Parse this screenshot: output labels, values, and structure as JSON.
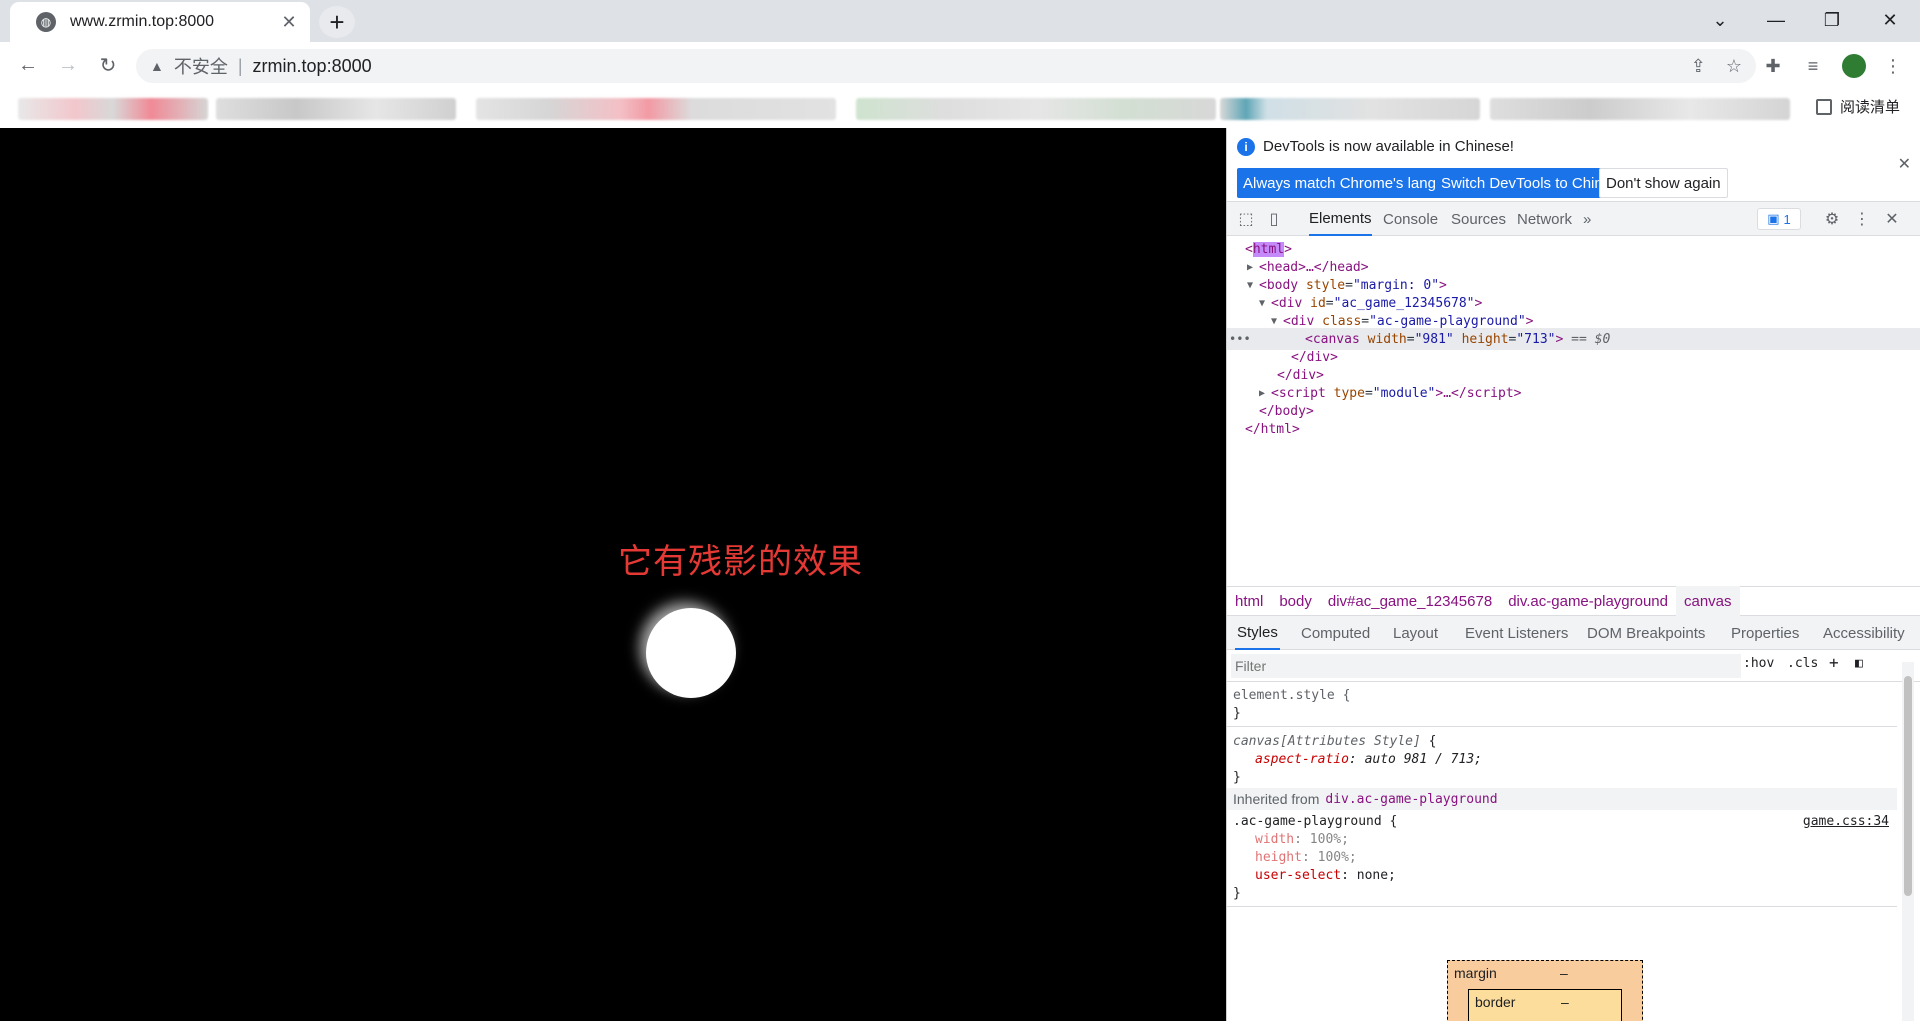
{
  "browser": {
    "tab_title": "www.zrmin.top:8000",
    "tab_close": "✕",
    "new_tab": "+",
    "window_controls": [
      "⌄",
      "—",
      "❐",
      "✕"
    ],
    "insecure_label": "不安全",
    "separator": "|",
    "url": "zrmin.top:8000",
    "reading_list": "阅读清单"
  },
  "page": {
    "caption": "它有残影的效果"
  },
  "devtools": {
    "info_message": "DevTools is now available in Chinese!",
    "info_buttons": [
      "Always match Chrome's language",
      "Switch DevTools to Chinese",
      "Don't show again"
    ],
    "close_info": "✕",
    "tabs": [
      "Elements",
      "Console",
      "Sources",
      "Network",
      "»"
    ],
    "issues_count": "1",
    "dom": {
      "l1_tag": "html",
      "l2": "<head>…</head>",
      "l3_tag": "body",
      "l3_attr": "style",
      "l3_val": "\"margin: 0\"",
      "l4_tag": "div",
      "l4_attr": "id",
      "l4_val": "\"ac_game_12345678\"",
      "l5_tag": "div",
      "l5_attr": "class",
      "l5_val": "\"ac-game-playground\"",
      "l6_tag": "canvas",
      "l6_attr1": "width",
      "l6_val1": "\"981\"",
      "l6_attr2": "height",
      "l6_val2": "\"713\"",
      "l6_eq": "== $0",
      "l7": "</div>",
      "l8": "</div>",
      "l9_tag": "script",
      "l9_attr": "type",
      "l9_val": "\"module\"",
      "l10": "</body>",
      "l11": "</html>"
    },
    "breadcrumbs": [
      "html",
      "body",
      "div#ac_game_12345678",
      "div.ac-game-playground",
      "canvas"
    ],
    "sub_tabs": [
      "Styles",
      "Computed",
      "Layout",
      "Event Listeners",
      "DOM Breakpoints",
      "Properties",
      "Accessibility"
    ],
    "filter_placeholder": "Filter",
    "filter_hov": ":hov",
    "filter_cls": ".cls",
    "filter_plus": "+",
    "styles": {
      "element_style": "element.style {",
      "close_brace": "}",
      "attr_selector": "canvas[Attributes Style]",
      "attr_open": " {",
      "aspect_prop": "aspect-ratio",
      "aspect_val": ": auto 981 / 713;",
      "inherited_label": "Inherited from",
      "inherited_link": "div.ac-game-playground",
      "rule_selector": ".ac-game-playground {",
      "rule_source": "game.css:34",
      "width_prop": "width",
      "width_val": ": 100%;",
      "height_prop": "height",
      "height_val": ": 100%;",
      "user_select_prop": "user-select",
      "user_select_val": ": none;"
    },
    "box_model": {
      "margin_label": "margin",
      "margin_val": "–",
      "border_label": "border",
      "border_val": "–"
    }
  }
}
